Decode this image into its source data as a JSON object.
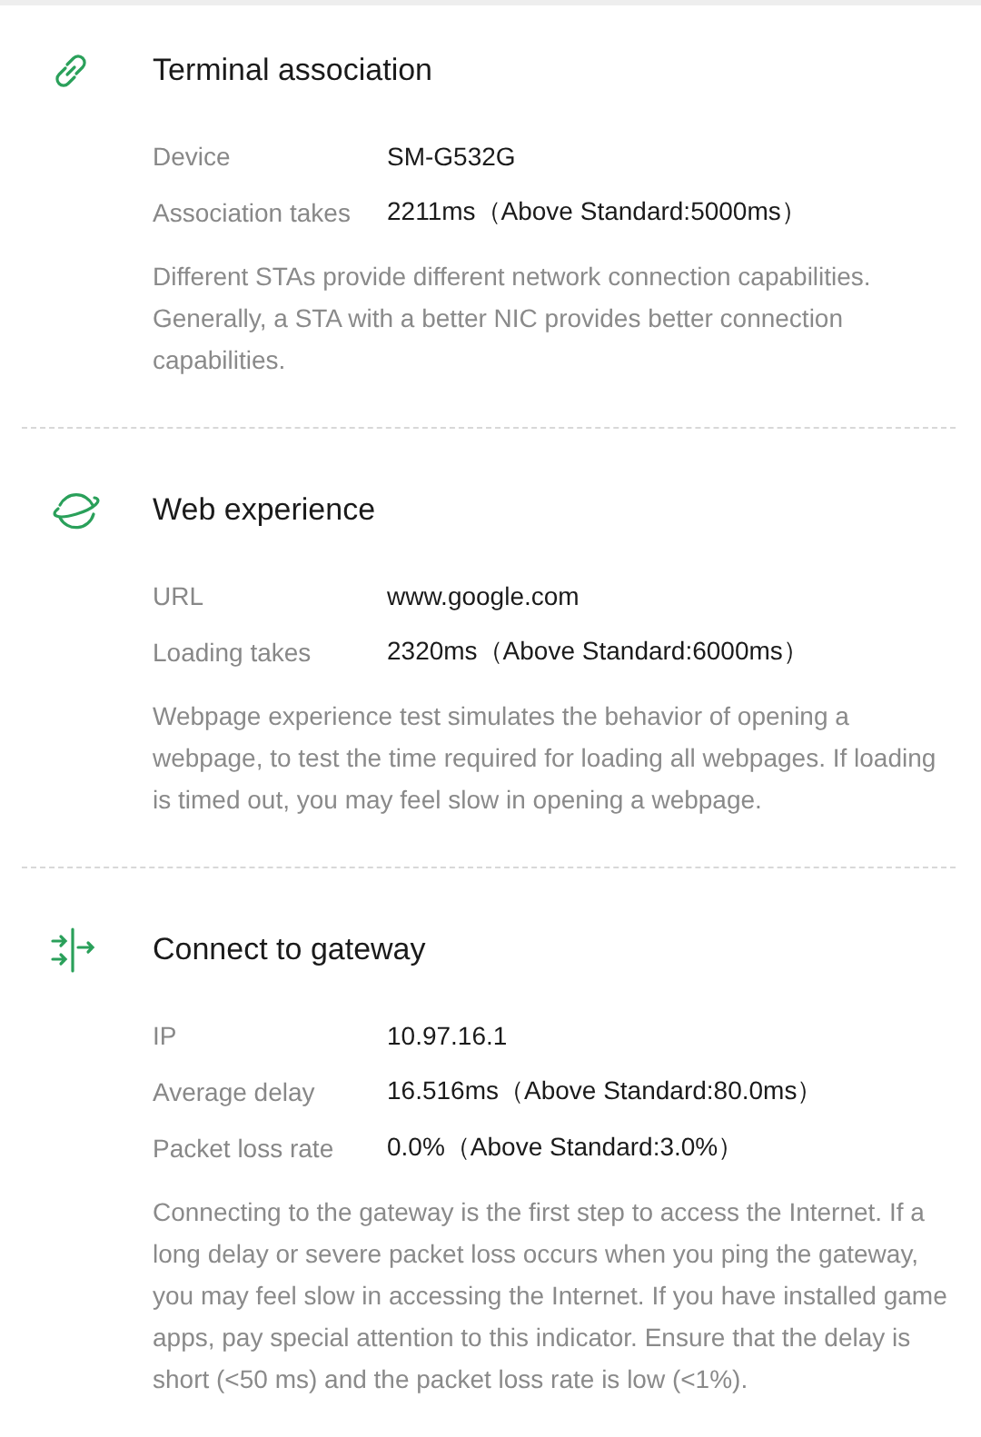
{
  "sections": [
    {
      "kind": "link",
      "title": "Terminal association",
      "rows": [
        {
          "label": "Device",
          "value": "SM-G532G"
        },
        {
          "label": "Association takes",
          "value": "2211ms（Above Standard:5000ms）"
        }
      ],
      "description": "Different STAs provide different network connection capabilities.  Generally, a STA with a better NIC provides better connection capabilities."
    },
    {
      "kind": "planet",
      "title": "Web experience",
      "rows": [
        {
          "label": "URL",
          "value": "www.google.com"
        },
        {
          "label": "Loading takes",
          "value": "2320ms（Above Standard:6000ms）"
        }
      ],
      "description": "Webpage experience test simulates the behavior of opening a webpage, to test the time required for loading all webpages. If loading is timed out, you may feel slow in opening a webpage."
    },
    {
      "kind": "gateway",
      "title": "Connect to gateway",
      "rows": [
        {
          "label": "IP",
          "value": "10.97.16.1"
        },
        {
          "label": "Average delay",
          "value": "16.516ms（Above Standard:80.0ms）"
        },
        {
          "label": "Packet loss rate",
          "value": "0.0%（Above Standard:3.0%）"
        }
      ],
      "description": "Connecting to the gateway is the first step to access the Internet. If a long delay or severe packet loss occurs when you ping the gateway, you may feel slow in accessing the Internet. If you have installed game apps, pay special attention to this indicator. Ensure that the delay is short (<50 ms) and the packet loss rate is low (<1%)."
    }
  ]
}
